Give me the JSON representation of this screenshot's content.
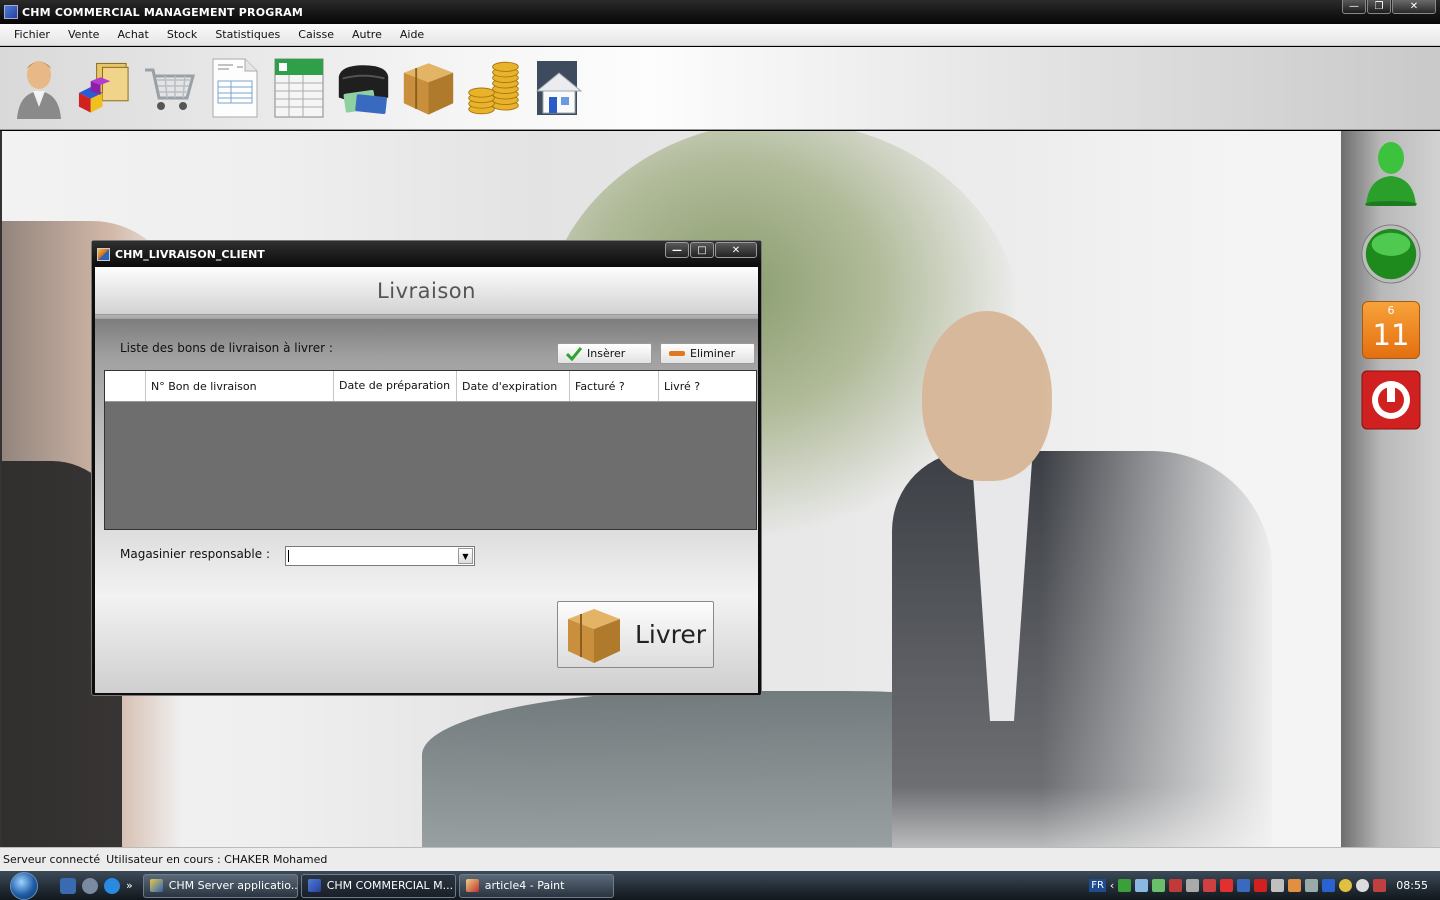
{
  "app": {
    "title": "CHM COMMERCIAL MANAGEMENT PROGRAM"
  },
  "menu": [
    "Fichier",
    "Vente",
    "Achat",
    "Stock",
    "Statistiques",
    "Caisse",
    "Autre",
    "Aide"
  ],
  "toolbar": {
    "icons": [
      "user-icon",
      "products-icon",
      "shopping-cart-icon",
      "invoice-document-icon",
      "spreadsheet-icon",
      "wallet-icon",
      "cardboard-box-icon",
      "gold-coins-icon",
      "home-icon"
    ]
  },
  "right_panel": {
    "calendar_month": "6",
    "calendar_day": "11"
  },
  "dialog": {
    "title": "CHM_LIVRAISON_CLIENT",
    "header": "Livraison",
    "list_label": "Liste des bons de livraison à livrer :",
    "insert_label": "Insèrer",
    "eliminate_label": "Eliminer",
    "columns": [
      "",
      "N° Bon de livraison",
      "Date de préparation",
      "Date d'expiration",
      "Facturé ?",
      "Livré ?"
    ],
    "rows": [],
    "storekeeper_label": "Magasinier responsable :",
    "storekeeper_value": "",
    "deliver_label": "Livrer"
  },
  "status": {
    "server": "Serveur connecté",
    "user": "Utilisateur en cours : CHAKER Mohamed"
  },
  "taskbar": {
    "tasks": [
      "CHM Server applicatio...",
      "CHM COMMERCIAL M...",
      "article4 - Paint"
    ],
    "active_task_index": 1,
    "lang": "FR",
    "clock": "08:55"
  },
  "colors": {
    "title_bar": "#0a0a0a",
    "accent_green": "#2fa32f",
    "accent_orange": "#f08c1a",
    "accent_red": "#c81e1e"
  }
}
